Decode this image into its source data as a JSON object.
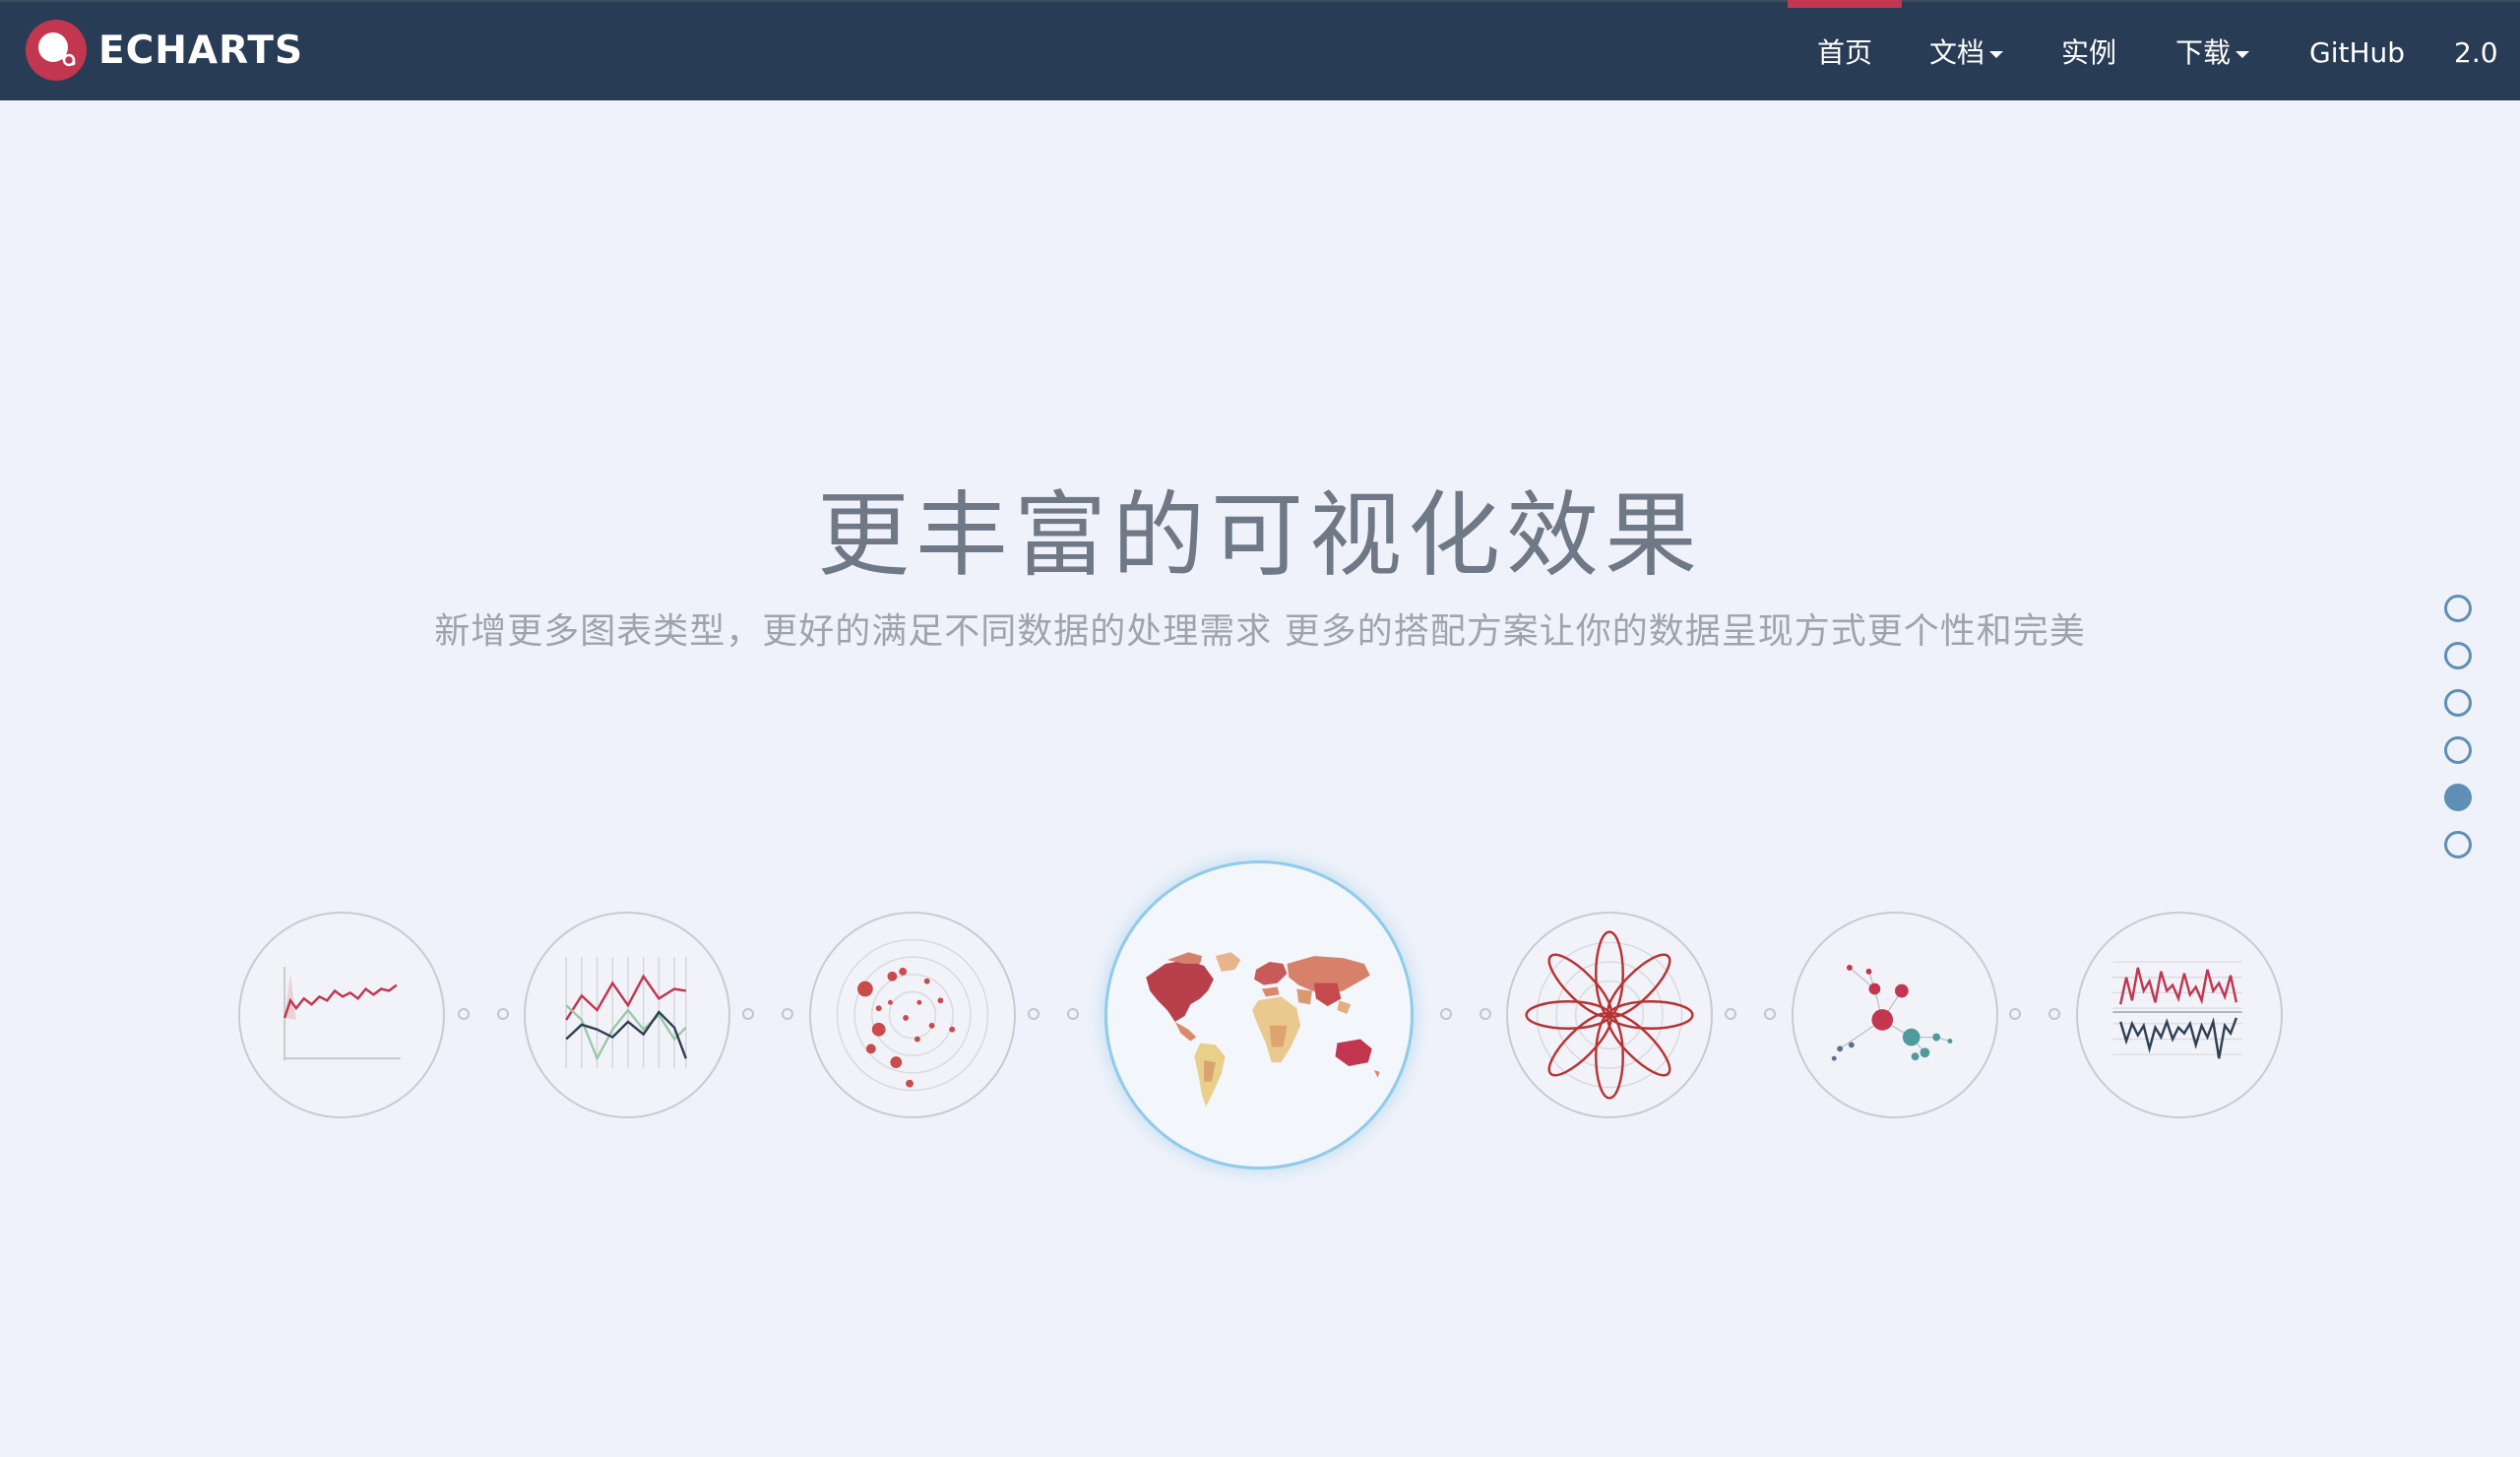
{
  "brand": {
    "name": "ECHARTS",
    "logo_icon": "echarts-logo-icon"
  },
  "nav": {
    "items": [
      {
        "label": "首页",
        "active": true
      },
      {
        "label": "文档",
        "dropdown": true
      },
      {
        "label": "实例"
      },
      {
        "label": "下载",
        "dropdown": true
      },
      {
        "label": "GitHub"
      },
      {
        "label": "2.0"
      }
    ]
  },
  "hero": {
    "title": "更丰富的可视化效果",
    "subtitle": "新增更多图表类型，更好的满足不同数据的处理需求 更多的搭配方案让你的数据呈现方式更个性和完美"
  },
  "showcase": [
    {
      "icon": "line-chart-icon"
    },
    {
      "icon": "multi-line-chart-icon"
    },
    {
      "icon": "polar-scatter-icon"
    },
    {
      "icon": "world-map-icon",
      "selected": true
    },
    {
      "icon": "rose-curve-icon"
    },
    {
      "icon": "force-graph-icon"
    },
    {
      "icon": "kline-chart-icon"
    }
  ],
  "pager": {
    "count": 6,
    "active_index": 4
  },
  "colors": {
    "navbar": "#293c55",
    "accent": "#c23650",
    "background": "#eff2fa",
    "pager": "#5f8fb4",
    "selected_ring": "#8fcbea"
  }
}
